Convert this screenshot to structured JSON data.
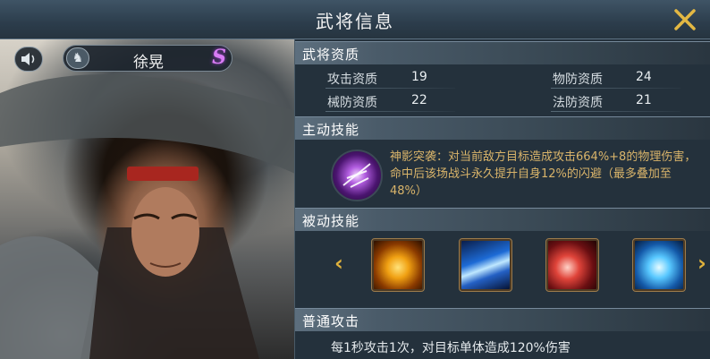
{
  "window": {
    "title": "武将信息"
  },
  "hero": {
    "name": "徐晃",
    "grade": "S"
  },
  "aptitude": {
    "header": "武将资质",
    "stats": [
      {
        "label": "攻击资质",
        "value": "19"
      },
      {
        "label": "物防资质",
        "value": "24"
      },
      {
        "label": "械防资质",
        "value": "22"
      },
      {
        "label": "法防资质",
        "value": "21"
      }
    ]
  },
  "active_skill": {
    "header": "主动技能",
    "description": "神影突袭：对当前敌方目标造成攻击664%+8的物理伤害，命中后该场战斗永久提升自身12%的闪避（最多叠加至48%）"
  },
  "passive_skills": {
    "header": "被动技能",
    "prev_arrow": "‹",
    "next_arrow": "›"
  },
  "normal_attack": {
    "header": "普通攻击",
    "description": "每1秒攻击1次，对目标单体造成120%伤害"
  },
  "icons": {
    "close": "close-icon",
    "sound": "speaker-icon",
    "clan": "horse-icon"
  },
  "colors": {
    "accent_gold": "#e0b23c",
    "skill_text": "#d9b46a",
    "grade_purple": "#d87cf4"
  }
}
